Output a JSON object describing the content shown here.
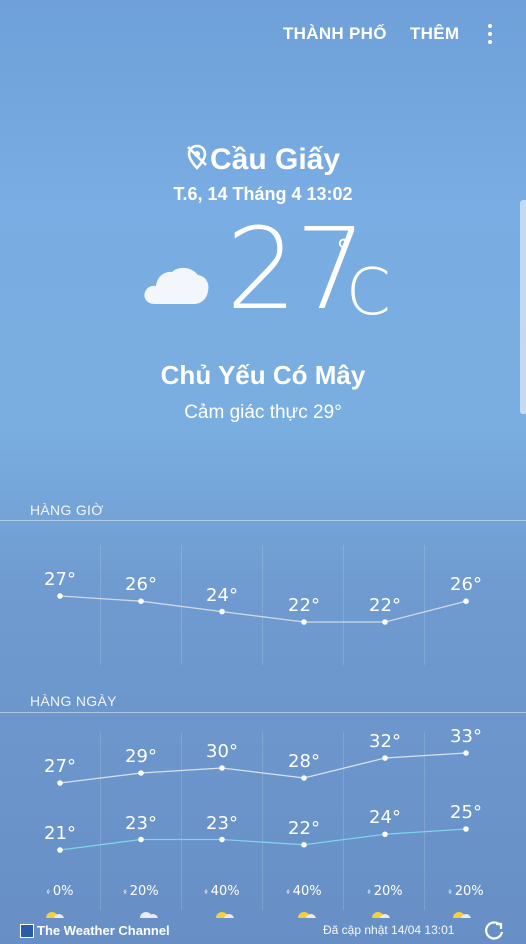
{
  "topbar": {
    "city_label": "THÀNH PHỐ",
    "more_label": "THÊM"
  },
  "current": {
    "location": "Cầu Giấy",
    "datetime": "T.6, 14 Tháng 4 13:02",
    "temperature": "27",
    "degree_symbol": "°",
    "unit": "C",
    "condition": "Chủ Yếu Có Mây",
    "feels_like": "Cảm giác thực 29°",
    "icon": "cloud-icon"
  },
  "hourly": {
    "label": "HÀNG GIỜ",
    "temps": [
      "27°",
      "26°",
      "24°",
      "22°",
      "22°",
      "26°"
    ],
    "values": [
      27,
      26,
      24,
      22,
      22,
      26
    ]
  },
  "daily": {
    "label": "HÀNG NGÀY",
    "highs": [
      "27°",
      "29°",
      "30°",
      "28°",
      "32°",
      "33°"
    ],
    "high_values": [
      27,
      29,
      30,
      28,
      32,
      33
    ],
    "lows": [
      "21°",
      "23°",
      "23°",
      "22°",
      "24°",
      "25°"
    ],
    "low_values": [
      21,
      23,
      23,
      22,
      24,
      25
    ],
    "precip": [
      "0%",
      "20%",
      "40%",
      "40%",
      "20%",
      "20%"
    ]
  },
  "footer": {
    "provider": "The Weather Channel",
    "updated": "Đã cập nhật  14/04  13:01"
  },
  "colors": {
    "high_line": "#d8e2ee",
    "low_line": "#7fd3e8"
  }
}
